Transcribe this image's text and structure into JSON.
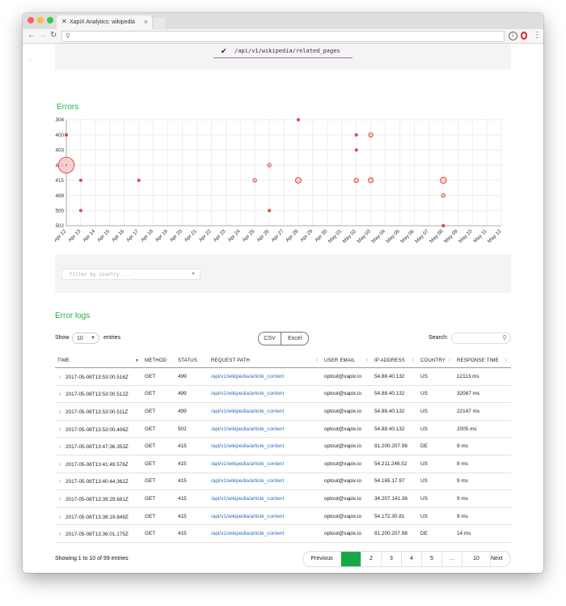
{
  "browser": {
    "tab_title": "XapiX Analytics: wikipedia",
    "tab_icon": "xapix-logo-icon"
  },
  "top": {
    "selected_route": "/api/v1/wikipedia/related_pages"
  },
  "errors_section": {
    "title": "Errors",
    "chart_data": {
      "type": "scatter",
      "y_categories": [
        "304",
        "400",
        "403",
        "404",
        "415",
        "499",
        "500",
        "502"
      ],
      "x_ticks": [
        "Apr 12",
        "Apr 13",
        "Apr 14",
        "Apr 15",
        "Apr 16",
        "Apr 17",
        "Apr 18",
        "Apr 19",
        "Apr 20",
        "Apr 21",
        "Apr 22",
        "Apr 23",
        "Apr 24",
        "Apr 25",
        "Apr 26",
        "Apr 27",
        "Apr 28",
        "Apr 29",
        "Apr 30",
        "May 01",
        "May 02",
        "May 03",
        "May 04",
        "May 05",
        "May 06",
        "May 07",
        "May 08",
        "May 09",
        "May 10",
        "May 11",
        "May 12"
      ],
      "points": [
        {
          "x": "Apr 12",
          "y": "400",
          "count": 1
        },
        {
          "x": "Apr 12",
          "y": "404",
          "count": 40
        },
        {
          "x": "Apr 13",
          "y": "415",
          "count": 1
        },
        {
          "x": "Apr 13",
          "y": "500",
          "count": 1
        },
        {
          "x": "Apr 17",
          "y": "415",
          "count": 1
        },
        {
          "x": "Apr 25",
          "y": "415",
          "count": 2
        },
        {
          "x": "Apr 26",
          "y": "404",
          "count": 2
        },
        {
          "x": "Apr 26",
          "y": "500",
          "count": 1
        },
        {
          "x": "Apr 28",
          "y": "304",
          "count": 1
        },
        {
          "x": "Apr 28",
          "y": "415",
          "count": 5
        },
        {
          "x": "May 02",
          "y": "400",
          "count": 1
        },
        {
          "x": "May 02",
          "y": "403",
          "count": 1
        },
        {
          "x": "May 02",
          "y": "415",
          "count": 3
        },
        {
          "x": "May 03",
          "y": "400",
          "count": 3
        },
        {
          "x": "May 03",
          "y": "415",
          "count": 4
        },
        {
          "x": "May 08",
          "y": "415",
          "count": 6
        },
        {
          "x": "May 08",
          "y": "499",
          "count": 2
        },
        {
          "x": "May 08",
          "y": "502",
          "count": 1
        }
      ],
      "grid": true,
      "colors": {
        "marker": "#e53935",
        "marker_fill": "#f7c8c8"
      }
    },
    "filter_placeholder": "Filter by country ..."
  },
  "logs_section": {
    "title": "Error logs",
    "show_label": "Show",
    "show_value": "10",
    "entries_label": "entries",
    "csv_label": "CSV",
    "excel_label": "Excel",
    "search_label": "Search:",
    "columns": [
      "TIME",
      "METHOD",
      "STATUS",
      "REQUEST PATH",
      "USER EMAIL",
      "IP ADDRESS",
      "COUNTRY",
      "RESPONSE TIME"
    ],
    "rows": [
      {
        "time": "2017-05-08T13:53:00.516Z",
        "method": "GET",
        "status": "499",
        "path": "/api/v1/wikipedia/article_content",
        "email": "optout@xapix.io",
        "ip": "54.88.40.132",
        "country": "US",
        "response": "12113 ms"
      },
      {
        "time": "2017-05-08T13:53:00.512Z",
        "method": "GET",
        "status": "499",
        "path": "/api/v1/wikipedia/article_content",
        "email": "optout@xapix.io",
        "ip": "54.88.40.132",
        "country": "US",
        "response": "32087 ms"
      },
      {
        "time": "2017-05-08T13:53:00.511Z",
        "method": "GET",
        "status": "499",
        "path": "/api/v1/wikipedia/article_content",
        "email": "optout@xapix.io",
        "ip": "54.88.40.132",
        "country": "US",
        "response": "22147 ms"
      },
      {
        "time": "2017-05-08T13:53:00.406Z",
        "method": "GET",
        "status": "502",
        "path": "/api/v1/wikipedia/article_content",
        "email": "optout@xapix.io",
        "ip": "54.88.40.132",
        "country": "US",
        "response": "2005 ms"
      },
      {
        "time": "2017-05-08T13:47:36.353Z",
        "method": "GET",
        "status": "415",
        "path": "/api/v1/wikipedia/article_content",
        "email": "optout@xapix.io",
        "ip": "81.200.207.98",
        "country": "DE",
        "response": "9 ms"
      },
      {
        "time": "2017-05-08T13:41:49.576Z",
        "method": "GET",
        "status": "415",
        "path": "/api/v1/wikipedia/article_content",
        "email": "optout@xapix.io",
        "ip": "54.211.246.52",
        "country": "US",
        "response": "8 ms"
      },
      {
        "time": "2017-05-08T13:40:44.362Z",
        "method": "GET",
        "status": "415",
        "path": "/api/v1/wikipedia/article_content",
        "email": "optout@xapix.io",
        "ip": "54.165.17.97",
        "country": "US",
        "response": "9 ms"
      },
      {
        "time": "2017-05-08T13:39:29.681Z",
        "method": "GET",
        "status": "415",
        "path": "/api/v1/wikipedia/article_content",
        "email": "optout@xapix.io",
        "ip": "34.207.141.36",
        "country": "US",
        "response": "9 ms"
      },
      {
        "time": "2017-05-08T13:38:19.849Z",
        "method": "GET",
        "status": "415",
        "path": "/api/v1/wikipedia/article_content",
        "email": "optout@xapix.io",
        "ip": "54.172.30.81",
        "country": "US",
        "response": "9 ms"
      },
      {
        "time": "2017-05-08T13:36:01.175Z",
        "method": "GET",
        "status": "415",
        "path": "/api/v1/wikipedia/article_content",
        "email": "optout@xapix.io",
        "ip": "81.200.207.98",
        "country": "DE",
        "response": "14 ms"
      }
    ],
    "info": "Showing 1 to 10 of 99 entries",
    "pagination": {
      "previous": "Previous",
      "pages": [
        "1",
        "2",
        "3",
        "4",
        "5",
        "…",
        "10"
      ],
      "next": "Next",
      "active": "1"
    }
  }
}
